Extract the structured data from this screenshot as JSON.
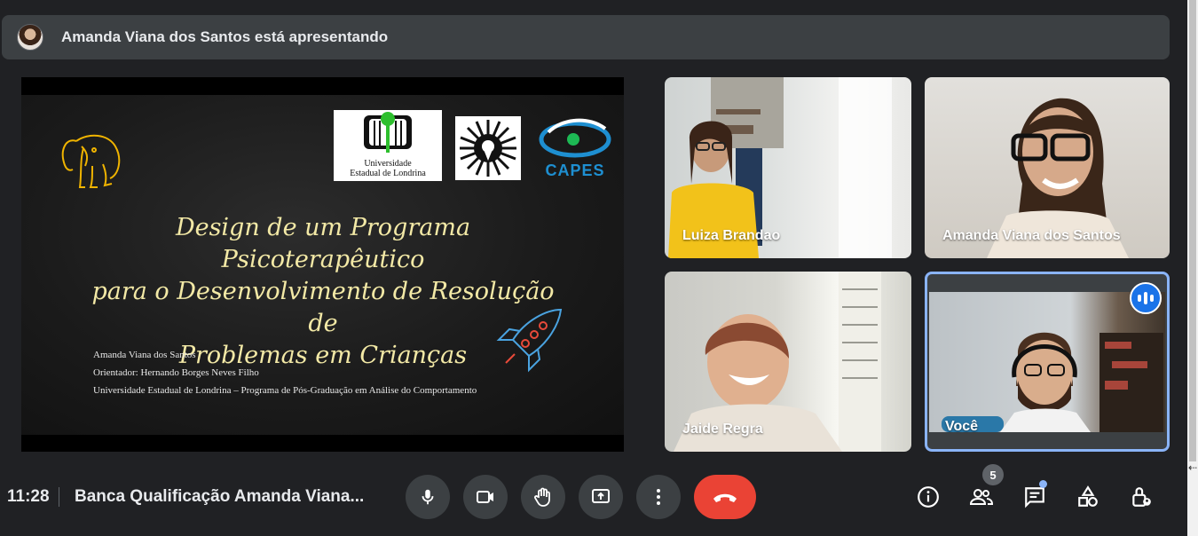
{
  "presenting": {
    "text": "Amanda Viana dos Santos está apresentando"
  },
  "slide": {
    "title_lines": [
      "Design de um Programa Psicoterapêutico",
      "para o Desenvolvimento de Resolução de",
      "Problemas em Crianças"
    ],
    "author": "Amanda Viana dos Santos",
    "advisor": "Orientador: Hernando Borges Neves Filho",
    "institution": "Universidade Estadual de Londrina – Programa de Pós-Graduação em Análise do Comportamento",
    "logo_uel": [
      "Universidade",
      "Estadual de Londrina"
    ],
    "logo_capes": "CAPES"
  },
  "participants": [
    {
      "name": "Luiza Brandao"
    },
    {
      "name": "Amanda Viana dos Santos"
    },
    {
      "name": "Jaide Regra"
    },
    {
      "name": "Você"
    }
  ],
  "bottom_bar": {
    "time": "11:28",
    "meeting_title": "Banca Qualificação Amanda Viana...",
    "people_count": "5"
  },
  "colors": {
    "background": "#202124",
    "control": "#3c4043",
    "end_call": "#ea4335",
    "accent": "#8ab4f8",
    "speaking": "#1a73e8",
    "slide_title": "#f3e9a6"
  },
  "icons": {
    "mic": "mic-icon",
    "camera": "videocam-icon",
    "hand": "raise-hand-icon",
    "present": "present-screen-icon",
    "more": "more-vert-icon",
    "end": "call-end-icon",
    "info": "info-icon",
    "people": "people-icon",
    "chat": "chat-icon",
    "activities": "activities-icon",
    "host": "host-controls-icon"
  }
}
